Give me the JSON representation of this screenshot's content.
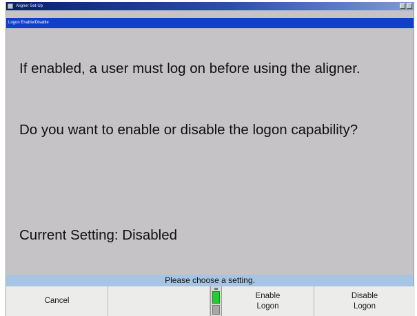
{
  "window": {
    "title": "Aligner Set-Up",
    "subtitle": "Logon Enable/Disable"
  },
  "message": {
    "line1": "If enabled, a user must log on before using the aligner.",
    "line2": "Do you want to enable or disable the logon capability?",
    "current_setting": "Current Setting: Disabled"
  },
  "status": {
    "text": "Please choose a setting."
  },
  "buttons": {
    "cancel": "Cancel",
    "blank": "",
    "enable_logon": "Enable\nLogon",
    "disable_logon": "Disable\nLogon"
  },
  "colors": {
    "title_bar": "#08206b",
    "subtitle_bar": "#0f40c8",
    "content_bg": "#c6c3c6",
    "status_bar": "#a7c5e2",
    "button_bar": "#ececea",
    "indicator_green": "#1fcf2f"
  },
  "icons": {
    "window_icon": "app-icon",
    "indicator": "status-indicator-icon"
  }
}
